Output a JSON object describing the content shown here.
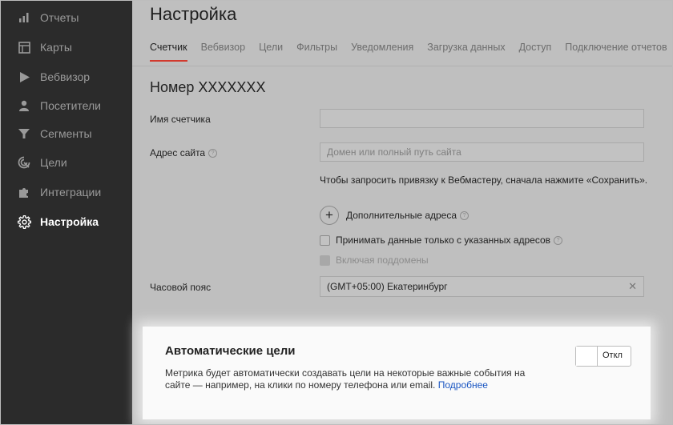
{
  "sidebar": {
    "items": [
      {
        "label": "Отчеты",
        "icon": "bar-chart-icon"
      },
      {
        "label": "Карты",
        "icon": "map-icon"
      },
      {
        "label": "Вебвизор",
        "icon": "play-icon"
      },
      {
        "label": "Посетители",
        "icon": "user-icon"
      },
      {
        "label": "Сегменты",
        "icon": "filter-icon"
      },
      {
        "label": "Цели",
        "icon": "target-icon"
      },
      {
        "label": "Интеграции",
        "icon": "puzzle-icon"
      },
      {
        "label": "Настройка",
        "icon": "gear-icon",
        "active": true
      }
    ]
  },
  "page": {
    "title": "Настройка"
  },
  "tabs": [
    {
      "label": "Счетчик",
      "active": true
    },
    {
      "label": "Вебвизор"
    },
    {
      "label": "Цели"
    },
    {
      "label": "Фильтры"
    },
    {
      "label": "Уведомления"
    },
    {
      "label": "Загрузка данных"
    },
    {
      "label": "Доступ"
    },
    {
      "label": "Подключение отчетов"
    }
  ],
  "form": {
    "section_title": "Номер XXXXXXX",
    "counter_name_label": "Имя счетчика",
    "counter_name_value": "",
    "site_label": "Адрес сайта",
    "site_placeholder": "Домен или полный путь сайта",
    "webmaster_note": "Чтобы запросить привязку к Вебмастеру, сначала нажмите «Сохранить».",
    "add_addresses_label": "Дополнительные адреса",
    "only_specified_label": "Принимать данные только с указанных адресов",
    "subdomains_label": "Включая поддомены",
    "timezone_label": "Часовой пояс",
    "timezone_value": "(GMT+05:00) Екатеринбург",
    "help_glyph": "?",
    "plus_glyph": "+",
    "clear_glyph": "✕"
  },
  "auto_goals": {
    "title": "Автоматические цели",
    "text": "Метрика будет автоматически создавать цели на некоторые важные события на сайте — например, на клики по номеру телефона или email.",
    "link": "Подробнее",
    "toggle_label": "Откл",
    "toggle_on": false
  },
  "colors": {
    "accent": "#d23a2e",
    "link": "#1a56c2",
    "sidebar_bg": "#2b2b2b"
  }
}
